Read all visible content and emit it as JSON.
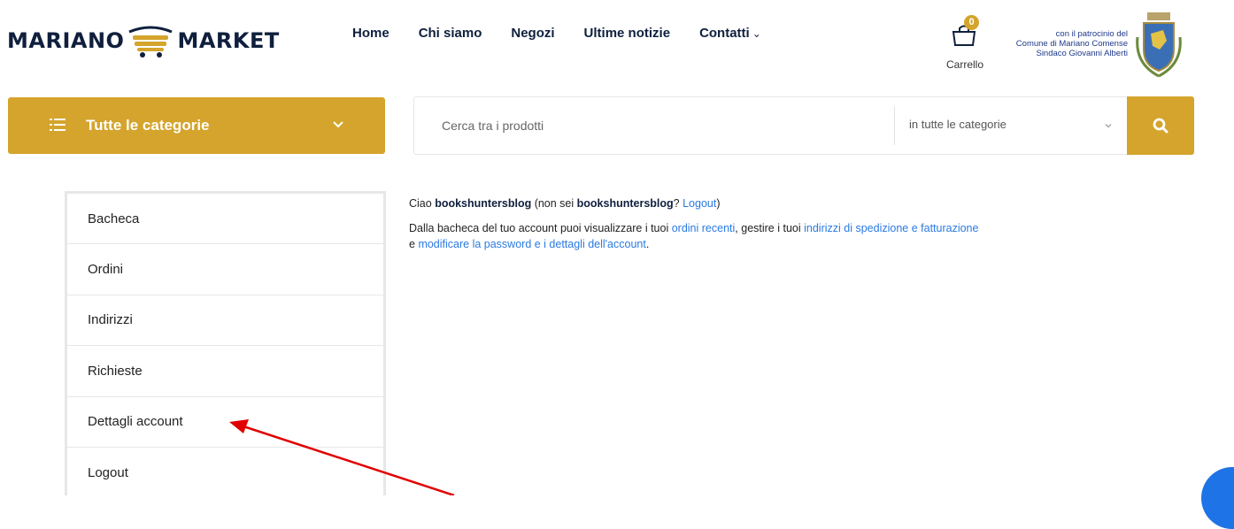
{
  "logo": {
    "left_word": "MARIANO",
    "right_word": "MARKET"
  },
  "nav": {
    "items": [
      {
        "label": "Home"
      },
      {
        "label": "Chi siamo"
      },
      {
        "label": "Negozi"
      },
      {
        "label": "Ultime notizie"
      },
      {
        "label": "Contatti"
      }
    ]
  },
  "cart": {
    "count": "0",
    "label": "Carrello"
  },
  "patron": {
    "line1": "con il patrocinio del",
    "line2": "Comune di Mariano Comense",
    "line3": "Sindaco Giovanni Alberti"
  },
  "categories": {
    "label": "Tutte le categorie"
  },
  "search": {
    "placeholder": "Cerca tra i prodotti",
    "category_selected": "in tutte le categorie"
  },
  "account_menu": {
    "items": [
      {
        "label": "Bacheca"
      },
      {
        "label": "Ordini"
      },
      {
        "label": "Indirizzi"
      },
      {
        "label": "Richieste"
      },
      {
        "label": "Dettagli account"
      },
      {
        "label": "Logout"
      }
    ]
  },
  "greeting": {
    "hello": "Ciao ",
    "username": "bookshuntersblog",
    "not_you_open": " (non sei ",
    "username2": "bookshuntersblog",
    "question": "? ",
    "logout_link": "Logout",
    "close": ")"
  },
  "intro": {
    "part1": "Dalla bacheca del tuo account puoi visualizzare i tuoi ",
    "link1": "ordini recenti",
    "part2": ", gestire i tuoi ",
    "link2": "indirizzi di spedizione e fatturazione",
    "part3": " e ",
    "link3": "modificare la password e i dettagli dell'account",
    "part4": "."
  },
  "colors": {
    "accent": "#d4a42c",
    "navy": "#0f1f3d",
    "link": "#2a7ae2",
    "annotation": "#e00000",
    "chat": "#1e73e6"
  },
  "icons": [
    "cart-logo-icon",
    "chevron-down-icon",
    "shopping-bag-icon",
    "coat-of-arms-icon",
    "list-icon",
    "search-icon",
    "annotation-arrow",
    "chat-icon"
  ]
}
